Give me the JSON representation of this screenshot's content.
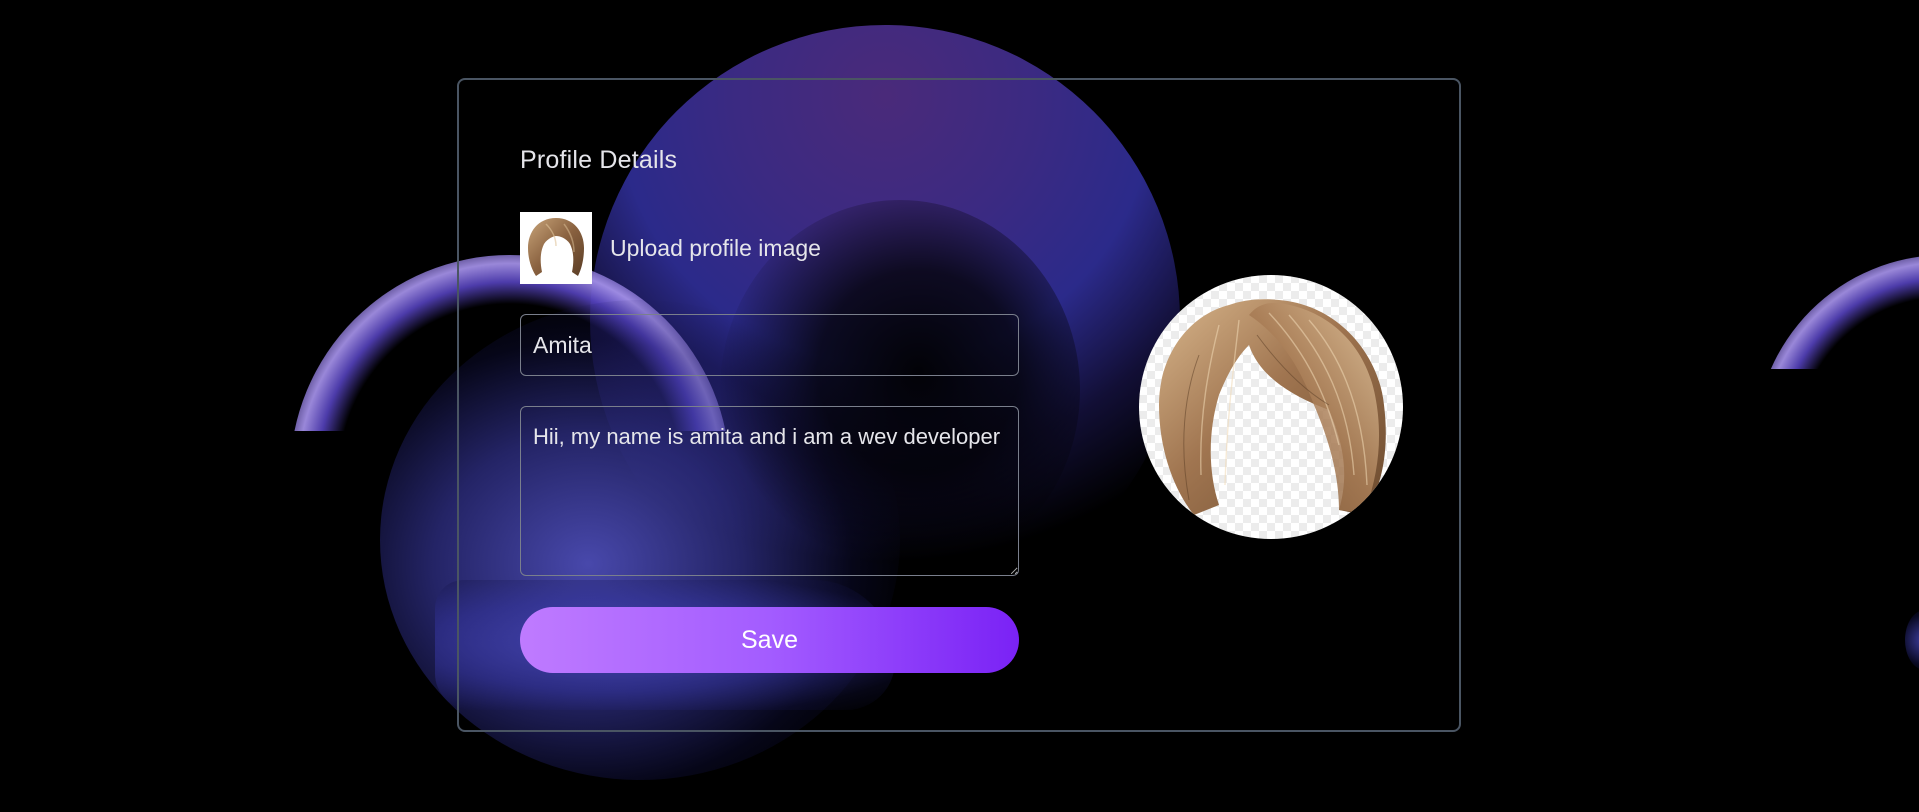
{
  "profile": {
    "title": "Profile Details",
    "upload_label": "Upload profile image",
    "name_value": "Amita",
    "bio_value": "Hii, my name is amita and i am a wev developer",
    "save_label": "Save",
    "thumbnail_icon": "wig-image",
    "avatar_icon": "wig-image"
  },
  "colors": {
    "background": "#000000",
    "card_border": "#4a5563",
    "text": "#e5e5ea",
    "button_gradient_start": "#bf7bff",
    "button_gradient_end": "#7a22f5",
    "accent_purple": "#3b2a82"
  }
}
